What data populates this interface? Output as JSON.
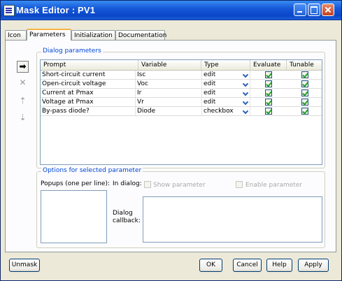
{
  "window": {
    "title": "Mask Editor : PV1"
  },
  "tabs": [
    {
      "label": "Icon"
    },
    {
      "label": "Parameters"
    },
    {
      "label": "Initialization"
    },
    {
      "label": "Documentation"
    }
  ],
  "dialog_parameters": {
    "title": "Dialog parameters",
    "columns": [
      "Prompt",
      "Variable",
      "Type",
      "Evaluate",
      "Tunable"
    ],
    "rows": [
      {
        "prompt": "Short-circuit current",
        "variable": "Isc",
        "type": "edit",
        "evaluate": true,
        "tunable": true
      },
      {
        "prompt": "Open-circuit voltage",
        "variable": "Voc",
        "type": "edit",
        "evaluate": true,
        "tunable": true
      },
      {
        "prompt": "Current at Pmax",
        "variable": "Ir",
        "type": "edit",
        "evaluate": true,
        "tunable": true
      },
      {
        "prompt": "Voltage at Pmax",
        "variable": "Vr",
        "type": "edit",
        "evaluate": true,
        "tunable": true
      },
      {
        "prompt": "By-pass diode?",
        "variable": "Diode",
        "type": "checkbox",
        "evaluate": true,
        "tunable": true
      }
    ]
  },
  "options": {
    "title": "Options for selected parameter",
    "popups_label": "Popups (one per line):",
    "in_dialog_label": "In dialog:",
    "show_parameter": "Show parameter",
    "enable_parameter": "Enable parameter",
    "callback_label_1": "Dialog",
    "callback_label_2": "callback:"
  },
  "buttons": {
    "unmask": "Unmask",
    "ok": "OK",
    "cancel": "Cancel",
    "help": "Help",
    "apply": "Apply"
  },
  "icons": {
    "side_buttons": [
      "add-parameter-icon",
      "delete-parameter-icon",
      "move-up-icon",
      "move-down-icon"
    ]
  }
}
